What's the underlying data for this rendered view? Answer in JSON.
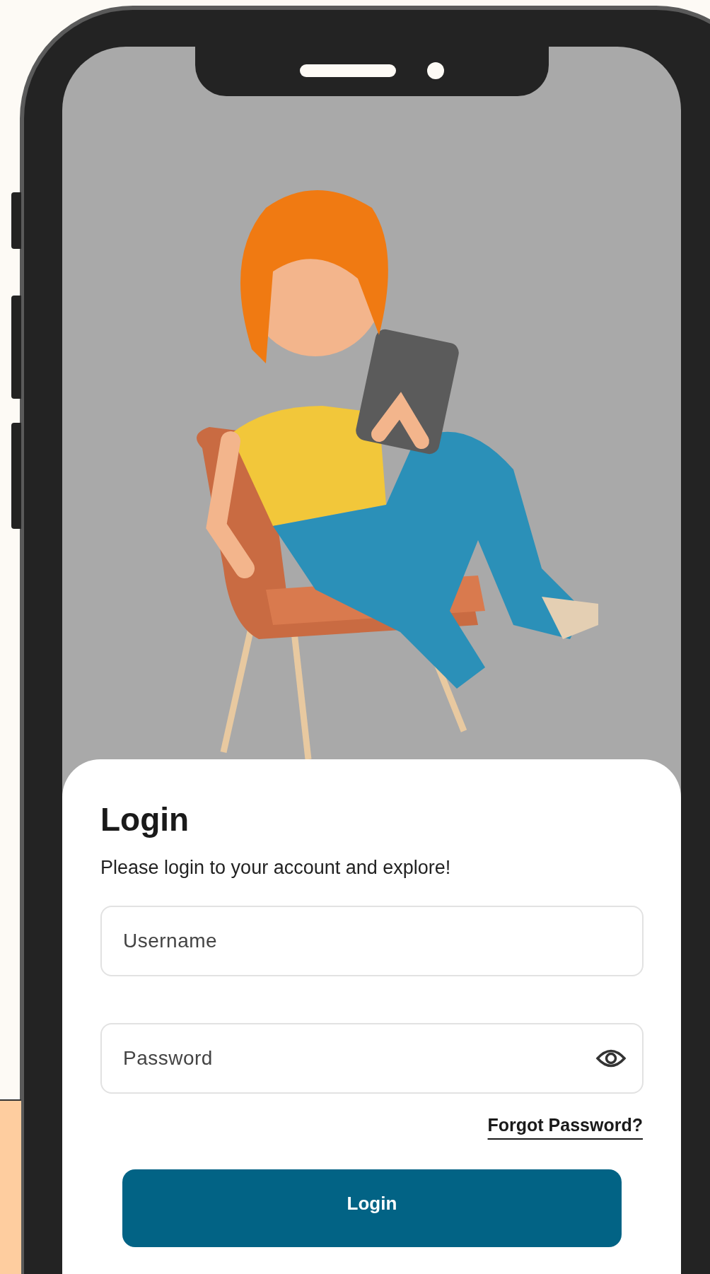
{
  "login_card": {
    "title": "Login",
    "subtitle": "Please login to your account and explore!",
    "username_field": {
      "placeholder": "Username"
    },
    "password_field": {
      "placeholder": "Password"
    },
    "forgot_password_link": "Forgot Password?",
    "login_button": "Login"
  }
}
